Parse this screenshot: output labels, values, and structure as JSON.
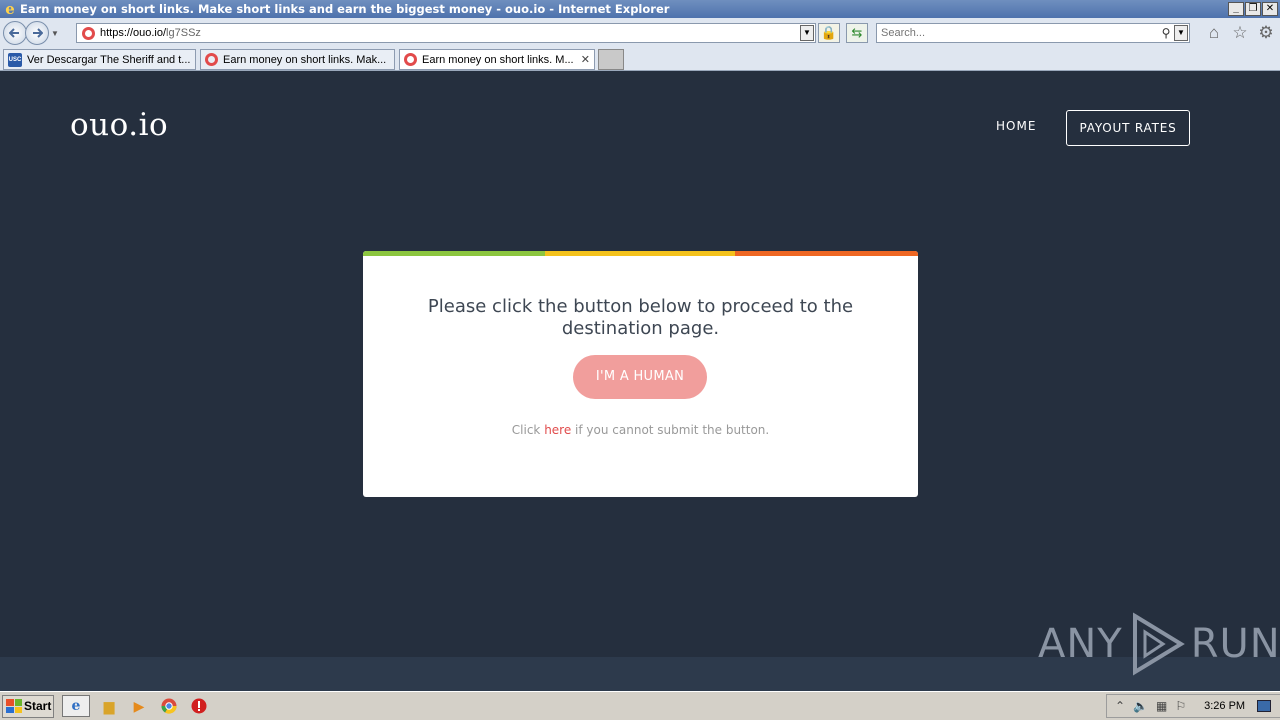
{
  "window": {
    "title": "Earn money on short links. Make short links and earn the biggest money - ouo.io - Internet Explorer",
    "min": "_",
    "restore": "❐",
    "close": "✕"
  },
  "addressbar": {
    "url_host": "https://ouo.io/",
    "url_path": "lg7SSz",
    "search_placeholder": "Search..."
  },
  "tabs": [
    {
      "label": "Ver Descargar The Sheriff and t...",
      "icon": "usc-icon",
      "icon_text": "USC"
    },
    {
      "label": "Earn money on short links. Mak...",
      "icon": "ouo-icon"
    },
    {
      "label": "Earn money on short links. M...",
      "icon": "ouo-icon",
      "active": true
    }
  ],
  "site": {
    "brand": "ouo.io",
    "nav_home": "HOME",
    "nav_payout": "PAYOUT RATES"
  },
  "card": {
    "message": "Please click the button below to proceed to the destination page.",
    "button": "I'M A HUMAN",
    "help_prefix": "Click ",
    "help_link": "here",
    "help_suffix": " if you cannot submit the button.",
    "colors": {
      "green": "#8cc63f",
      "yellow": "#f4c21c",
      "orange": "#ee6723",
      "button": "#f19e9c"
    }
  },
  "watermark": {
    "left": "ANY",
    "right": "RUN"
  },
  "taskbar": {
    "start": "Start",
    "clock": "3:26 PM"
  }
}
